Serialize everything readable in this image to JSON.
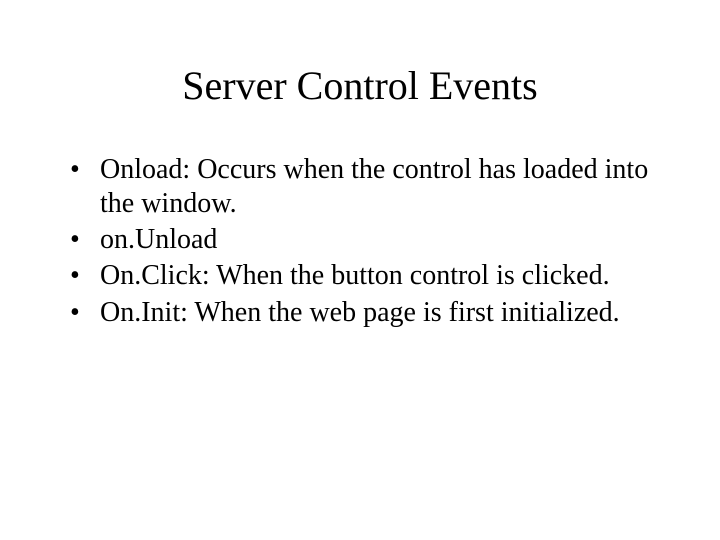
{
  "title": "Server Control Events",
  "bullets": [
    "Onload: Occurs when the control has loaded into the window.",
    "on.Unload",
    "On.Click: When the button control is clicked.",
    "On.Init: When the web page is first initialized."
  ]
}
